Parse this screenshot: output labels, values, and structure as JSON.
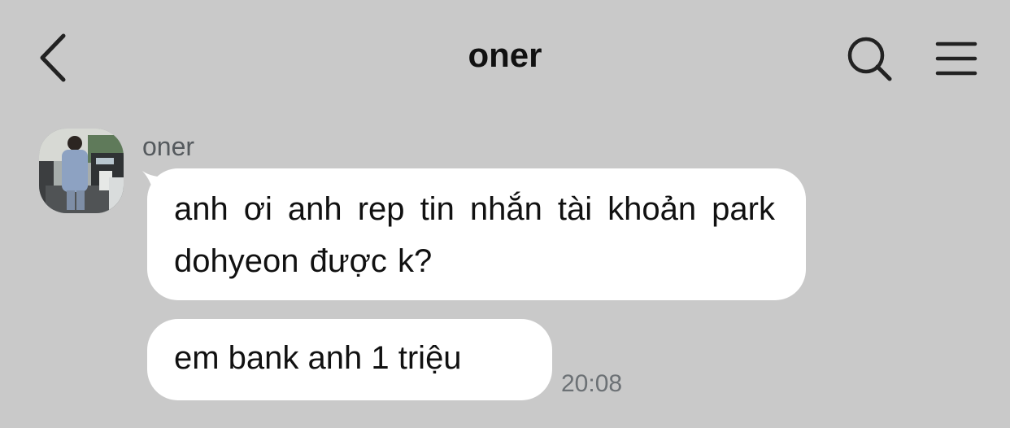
{
  "header": {
    "title": "oner",
    "back_icon": "chevron-left-icon",
    "search_icon": "search-icon",
    "menu_icon": "hamburger-menu-icon"
  },
  "conversation": {
    "sender": {
      "name": "oner",
      "avatar": "profile-photo"
    },
    "messages": [
      {
        "text": "anh ơi anh rep tin nhắn tài khoản park dohyeon được k?"
      },
      {
        "text": "em bank anh 1 triệu",
        "time": "20:08"
      }
    ]
  },
  "colors": {
    "background": "#c9c9c9",
    "bubble": "#ffffff",
    "text": "#111111",
    "secondary_text": "#6c7175"
  }
}
